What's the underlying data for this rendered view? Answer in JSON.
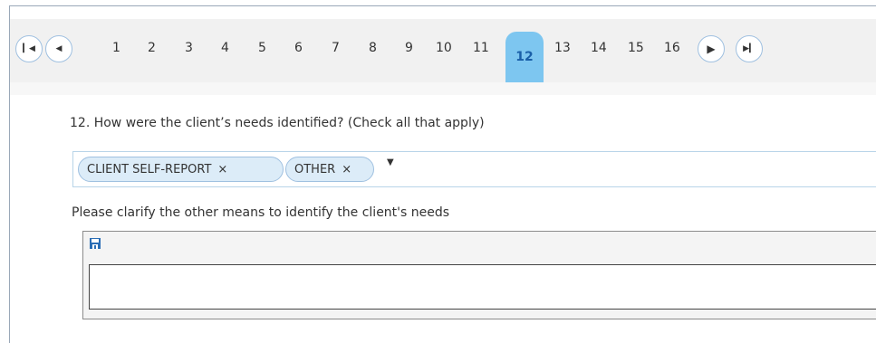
{
  "pager": {
    "first_icon": "first-page-icon",
    "prev_icon": "prev-page-icon",
    "next_icon": "next-page-icon",
    "last_icon": "last-page-icon",
    "pages": [
      "1",
      "2",
      "3",
      "4",
      "5",
      "6",
      "7",
      "8",
      "9",
      "10",
      "11",
      "12",
      "13",
      "14",
      "15",
      "16"
    ],
    "current": "12",
    "accent_color": "#7dc6f0"
  },
  "question": {
    "text": "12. How were the client’s needs identified? (Check all that apply)",
    "selected_tags": [
      "CLIENT SELF-REPORT",
      "OTHER"
    ],
    "remove_glyph": "×",
    "dropdown_icon": "dropdown-arrow-icon"
  },
  "clarify": {
    "label": "Please clarify the other means to identify the client's needs",
    "save_icon": "save-icon",
    "value": ""
  }
}
